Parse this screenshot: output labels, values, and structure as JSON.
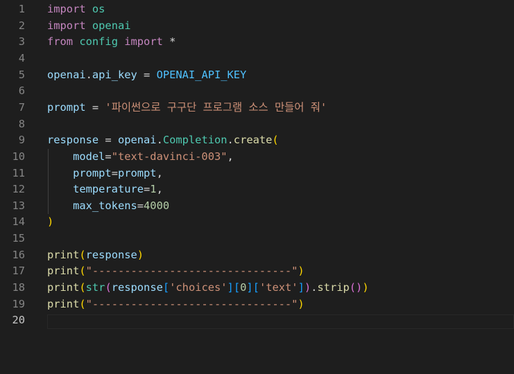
{
  "editor": {
    "active_line": 20,
    "lines": [
      {
        "n": "1",
        "tokens": [
          [
            "import",
            "kw"
          ],
          [
            " ",
            "op"
          ],
          [
            "os",
            "mod"
          ]
        ]
      },
      {
        "n": "2",
        "tokens": [
          [
            "import",
            "kw"
          ],
          [
            " ",
            "op"
          ],
          [
            "openai",
            "mod"
          ]
        ]
      },
      {
        "n": "3",
        "tokens": [
          [
            "from",
            "kw"
          ],
          [
            " ",
            "op"
          ],
          [
            "config",
            "mod"
          ],
          [
            " ",
            "op"
          ],
          [
            "import",
            "kw"
          ],
          [
            " *",
            "op"
          ]
        ]
      },
      {
        "n": "4",
        "tokens": []
      },
      {
        "n": "5",
        "tokens": [
          [
            "openai",
            "var"
          ],
          [
            ".",
            "op"
          ],
          [
            "api_key",
            "var"
          ],
          [
            " = ",
            "op"
          ],
          [
            "OPENAI_API_KEY",
            "const"
          ]
        ]
      },
      {
        "n": "6",
        "tokens": []
      },
      {
        "n": "7",
        "tokens": [
          [
            "prompt",
            "var"
          ],
          [
            " = ",
            "op"
          ],
          [
            "'파이썬으로 구구단 프로그램 소스 만들어 줘'",
            "str"
          ]
        ]
      },
      {
        "n": "8",
        "tokens": []
      },
      {
        "n": "9",
        "tokens": [
          [
            "response",
            "var"
          ],
          [
            " = ",
            "op"
          ],
          [
            "openai",
            "var"
          ],
          [
            ".",
            "op"
          ],
          [
            "Completion",
            "mod"
          ],
          [
            ".",
            "op"
          ],
          [
            "create",
            "fn"
          ],
          [
            "(",
            "b1"
          ]
        ]
      },
      {
        "n": "10",
        "tokens": [
          [
            "    ",
            "op"
          ],
          [
            "model",
            "var"
          ],
          [
            "=",
            "op"
          ],
          [
            "\"text-davinci-003\"",
            "str"
          ],
          [
            ",",
            "op"
          ]
        ]
      },
      {
        "n": "11",
        "tokens": [
          [
            "    ",
            "op"
          ],
          [
            "prompt",
            "var"
          ],
          [
            "=",
            "op"
          ],
          [
            "prompt",
            "var"
          ],
          [
            ",",
            "op"
          ]
        ]
      },
      {
        "n": "12",
        "tokens": [
          [
            "    ",
            "op"
          ],
          [
            "temperature",
            "var"
          ],
          [
            "=",
            "op"
          ],
          [
            "1",
            "num"
          ],
          [
            ",",
            "op"
          ]
        ]
      },
      {
        "n": "13",
        "tokens": [
          [
            "    ",
            "op"
          ],
          [
            "max_tokens",
            "var"
          ],
          [
            "=",
            "op"
          ],
          [
            "4000",
            "num"
          ]
        ]
      },
      {
        "n": "14",
        "tokens": [
          [
            ")",
            "b1"
          ]
        ]
      },
      {
        "n": "15",
        "tokens": []
      },
      {
        "n": "16",
        "tokens": [
          [
            "print",
            "fn"
          ],
          [
            "(",
            "b1"
          ],
          [
            "response",
            "var"
          ],
          [
            ")",
            "b1"
          ]
        ]
      },
      {
        "n": "17",
        "tokens": [
          [
            "print",
            "fn"
          ],
          [
            "(",
            "b1"
          ],
          [
            "\"-------------------------------\"",
            "str"
          ],
          [
            ")",
            "b1"
          ]
        ]
      },
      {
        "n": "18",
        "tokens": [
          [
            "print",
            "fn"
          ],
          [
            "(",
            "b1"
          ],
          [
            "str",
            "mod"
          ],
          [
            "(",
            "b2"
          ],
          [
            "response",
            "var"
          ],
          [
            "[",
            "b3"
          ],
          [
            "'choices'",
            "str"
          ],
          [
            "]",
            "b3"
          ],
          [
            "[",
            "b3"
          ],
          [
            "0",
            "num"
          ],
          [
            "]",
            "b3"
          ],
          [
            "[",
            "b3"
          ],
          [
            "'text'",
            "str"
          ],
          [
            "]",
            "b3"
          ],
          [
            ")",
            "b2"
          ],
          [
            ".",
            "op"
          ],
          [
            "strip",
            "fn"
          ],
          [
            "(",
            "b2"
          ],
          [
            ")",
            "b2"
          ],
          [
            ")",
            "b1"
          ]
        ]
      },
      {
        "n": "19",
        "tokens": [
          [
            "print",
            "fn"
          ],
          [
            "(",
            "b1"
          ],
          [
            "\"-------------------------------\"",
            "str"
          ],
          [
            ")",
            "b1"
          ]
        ]
      },
      {
        "n": "20",
        "tokens": []
      }
    ]
  }
}
